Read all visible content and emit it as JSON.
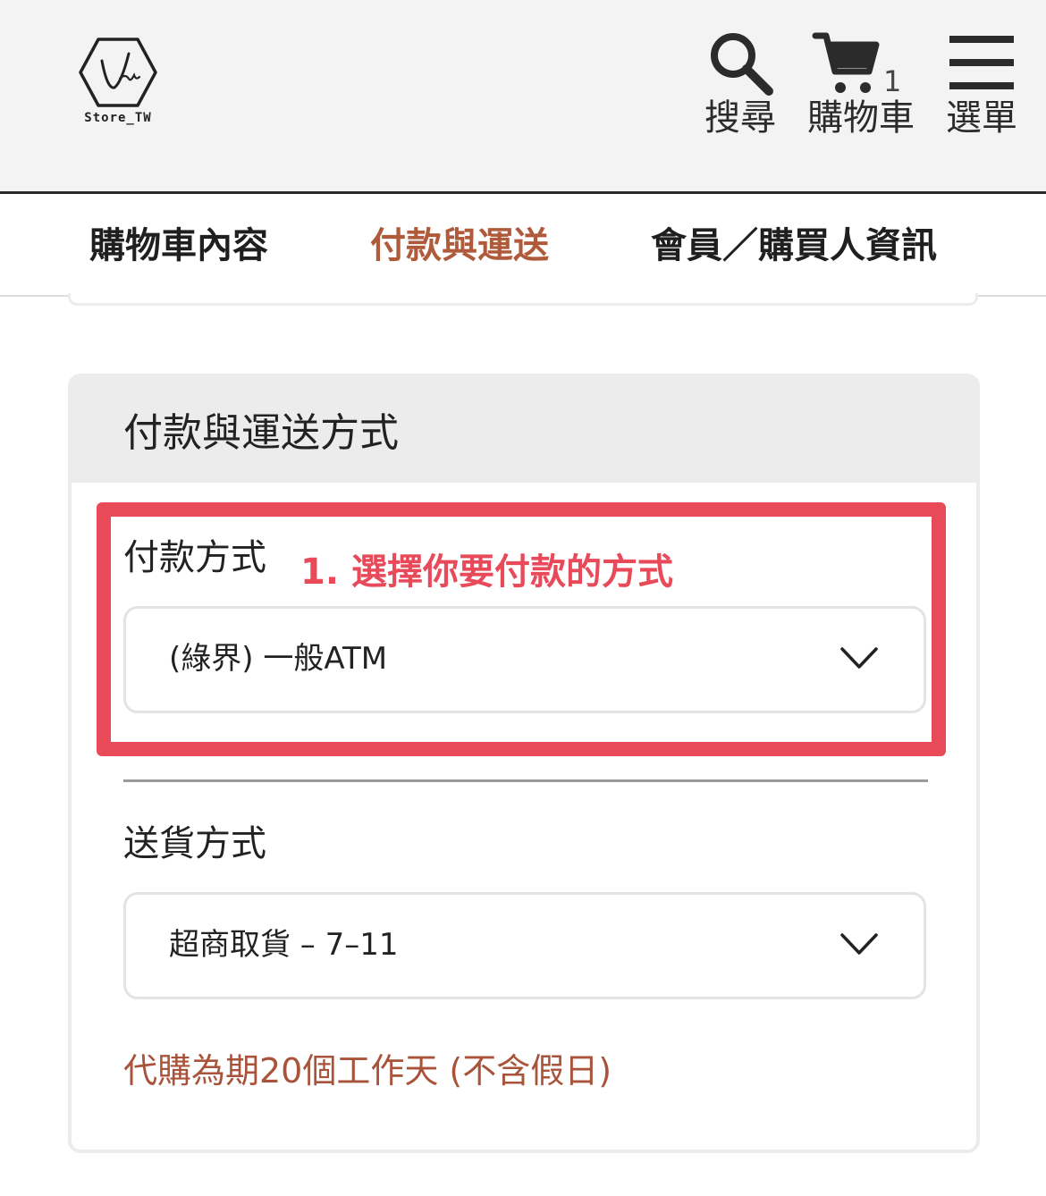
{
  "header": {
    "logo_text": "Store_TW",
    "logo_signature": "Van",
    "search_label": "搜尋",
    "cart_label": "購物車",
    "cart_count": "1",
    "menu_label": "選單"
  },
  "steps": [
    {
      "label": "購物車內容"
    },
    {
      "label": "付款與運送",
      "active": true
    },
    {
      "label": "會員／購買人資訊"
    }
  ],
  "colors": {
    "active_step": "#b05a3c",
    "note": "#a8533a",
    "annotation": "#e94a5a",
    "header_bg": "#f3f3f3"
  },
  "card": {
    "title": "付款與運送方式",
    "payment": {
      "label": "付款方式",
      "selected": "(綠界) 一般ATM"
    },
    "shipping": {
      "label": "送貨方式",
      "selected": "超商取貨 – 7–11"
    },
    "note": "代購為期20個工作天 (不含假日)"
  },
  "annotation": {
    "text": "1. 選擇你要付款的方式"
  }
}
